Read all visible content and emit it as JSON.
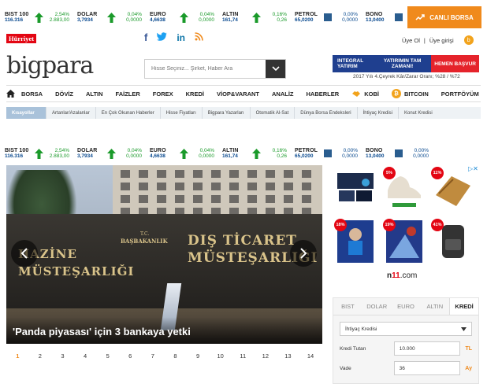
{
  "ticker": [
    {
      "name": "BIST 100",
      "value": "116.316",
      "dir": "up",
      "pct": "2,54%",
      "chg": "2.883,00"
    },
    {
      "name": "DOLAR",
      "value": "3,7934",
      "dir": "up",
      "pct": "0,04%",
      "chg": "0,0000"
    },
    {
      "name": "EURO",
      "value": "4,6638",
      "dir": "up",
      "pct": "0,04%",
      "chg": "0,0000"
    },
    {
      "name": "ALTIN",
      "value": "161,74",
      "dir": "up",
      "pct": "0,16%",
      "chg": "0,26"
    },
    {
      "name": "PETROL",
      "value": "65,0200",
      "dir": "flat",
      "pct": "0,00%",
      "chg": "0,0000"
    },
    {
      "name": "BONO",
      "value": "13,0400",
      "dir": "flat",
      "pct": "0,00%",
      "chg": "0,0000"
    }
  ],
  "header": {
    "live_button": "CANLI BORSA",
    "brand": "Hürriyet",
    "signup": "Üye Ol",
    "separator": "|",
    "login": "Üye girişi",
    "logo": "bigpara",
    "search_placeholder": "Hisse Seçiniz... Şirket, Haber Ara"
  },
  "ad": {
    "brand": "INTEGRAL YATIRIM",
    "headline": "YATIRIMIN TAM ZAMANI!",
    "cta": "HEMEN BAŞVUR",
    "caption": "2017 Yılı 4.Çeyrek Kâr/Zarar Oranı; %28 / %72"
  },
  "nav": [
    "BORSA",
    "DÖVİZ",
    "ALTIN",
    "FAİZLER",
    "FOREX",
    "KREDİ",
    "VİOP&VARANT",
    "ANALİZ",
    "HABERLER",
    "KOBİ",
    "BITCOIN",
    "PORTFÖYÜM"
  ],
  "subnav": [
    "Kısayollar",
    "Artanlar/Azalanlar",
    "En Çok Okunan Haberler",
    "Hisse Fiyatları",
    "Bigpara Yazarları",
    "Otomatik Al-Sat",
    "Dünya Borsa Endeksleri",
    "İhtiyaç Kredisi",
    "Konut Kredisi"
  ],
  "slider": {
    "caption": "'Panda piyasası' için 3 bankaya yetki",
    "sign_left_1": "HAZİNE",
    "sign_left_2": "MÜSTEŞARLIĞI",
    "sign_tc": "T.C.",
    "sign_pm": "BAŞBAKANLIK",
    "sign_right_1": "DIŞ TİCARET",
    "sign_right_2": "MÜSTEŞARLIĞI",
    "pages": [
      "1",
      "2",
      "3",
      "4",
      "5",
      "6",
      "7",
      "8",
      "9",
      "10",
      "11",
      "12",
      "13",
      "14"
    ],
    "active_page": 0
  },
  "products": {
    "badges": [
      "5%",
      "11%",
      "18%",
      "19%",
      "41%"
    ],
    "shop_logo_a": "n",
    "shop_logo_b": "11",
    "shop_logo_c": ".com"
  },
  "converter": {
    "tabs": [
      "BIST",
      "DOLAR",
      "EURO",
      "ALTIN",
      "KREDİ"
    ],
    "active_tab": 4,
    "loan_type": "İhtiyaç Kredisi",
    "amount_label": "Kredi Tutarı",
    "amount_value": "10.000",
    "amount_unit": "TL",
    "term_label": "Vade",
    "term_value": "36",
    "term_unit": "Ay"
  }
}
